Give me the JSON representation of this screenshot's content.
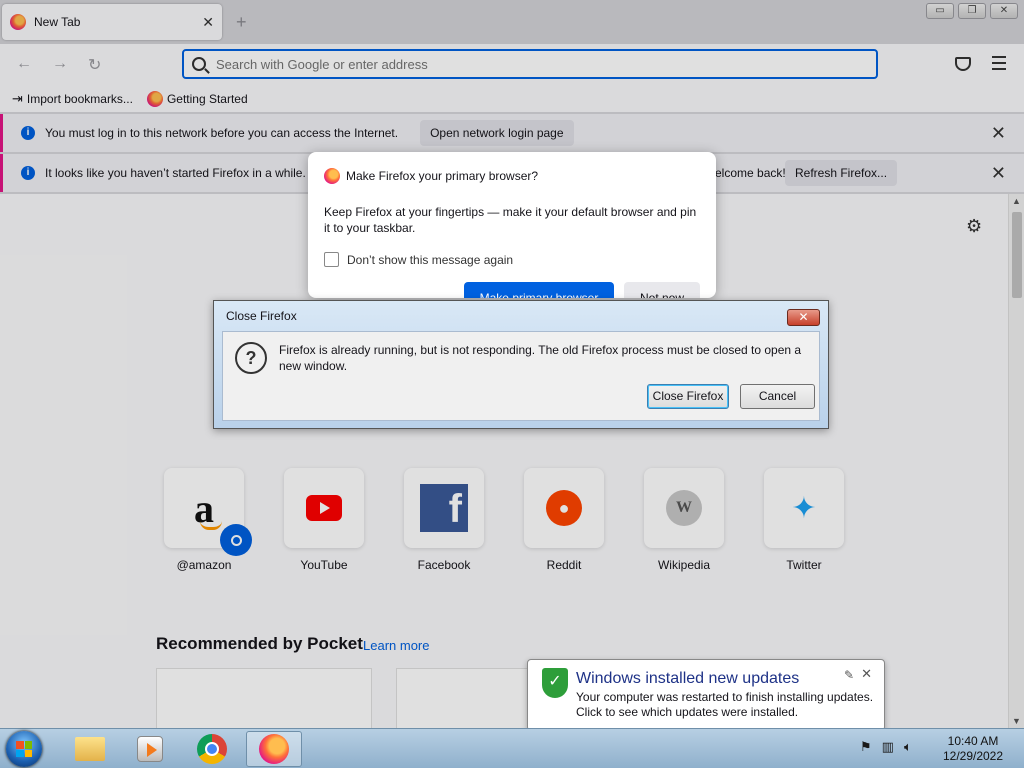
{
  "browser": {
    "tab_title": "New Tab",
    "tab_close": "✕",
    "new_tab": "+",
    "window_buttons": [
      "▭",
      "❐",
      "✕"
    ],
    "url_placeholder": "Search with Google or enter address"
  },
  "bookmarks": [
    {
      "label": "Import bookmarks..."
    },
    {
      "label": "Getting Started"
    }
  ],
  "notifications": [
    {
      "text": "You must log in to this network before you can access the Internet.",
      "button": "Open network login page"
    },
    {
      "text": "It looks like you haven’t started Firefox in a while. D",
      "trailing": "elcome back!",
      "button": "Refresh Firefox..."
    }
  ],
  "primary_dialog": {
    "title": "Make Firefox your primary browser?",
    "body": "Keep Firefox at your fingertips — make it your default browser and pin it to your taskbar.",
    "checkbox_label": "Don’t show this message again",
    "primary_button": "Make primary browser",
    "secondary_button": "Not now"
  },
  "close_dialog": {
    "title": "Close Firefox",
    "message": "Firefox is already running, but is not responding. The old Firefox process must be closed to open a new window.",
    "close_button": "Close Firefox",
    "cancel_button": "Cancel",
    "x_label": "✕"
  },
  "top_sites": [
    {
      "name": "@amazon",
      "icon": "amazon-icon"
    },
    {
      "name": "YouTube",
      "icon": "youtube-icon"
    },
    {
      "name": "Facebook",
      "icon": "facebook-icon"
    },
    {
      "name": "Reddit",
      "icon": "reddit-icon"
    },
    {
      "name": "Wikipedia",
      "icon": "wikipedia-icon"
    },
    {
      "name": "Twitter",
      "icon": "twitter-icon"
    }
  ],
  "pocket": {
    "title": "Recommended by Pocket",
    "learn_more": "Learn more"
  },
  "balloon": {
    "title": "Windows installed new updates",
    "line1": "Your computer was restarted to finish installing updates.",
    "line2": "Click to see which updates were installed."
  },
  "taskbar": {
    "time": "10:40 AM",
    "date": "12/29/2022"
  },
  "colors": {
    "accent": "#0061e0",
    "notif_stripe": "#e31587"
  }
}
